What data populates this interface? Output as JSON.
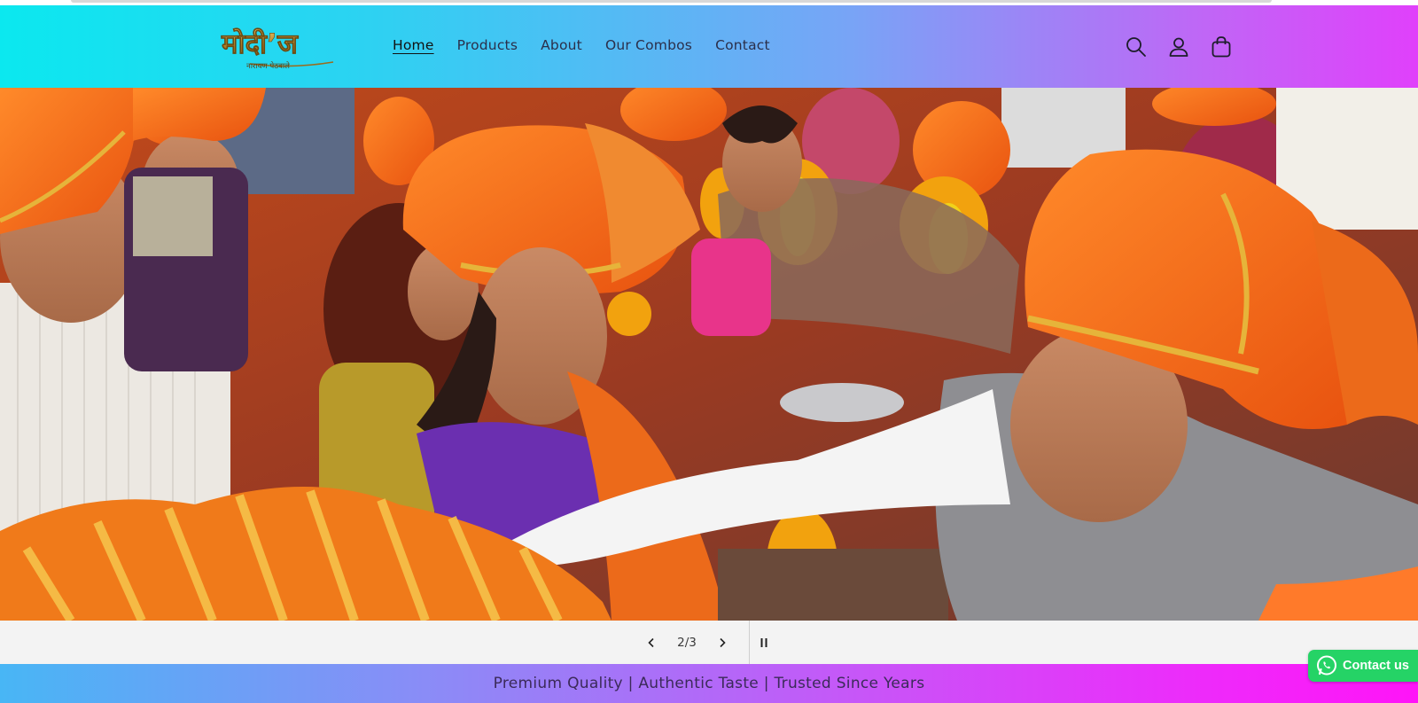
{
  "brand": {
    "logo_text": "मोदी’ज",
    "logo_subtext": "नारायण पेठवाले"
  },
  "nav": {
    "items": [
      {
        "label": "Home",
        "active": true
      },
      {
        "label": "Products",
        "active": false
      },
      {
        "label": "About",
        "active": false
      },
      {
        "label": "Our Combos",
        "active": false
      },
      {
        "label": "Contact",
        "active": false
      }
    ]
  },
  "header_icons": [
    "search-icon",
    "account-icon",
    "cart-icon"
  ],
  "hero": {
    "image": "festival-procession-with-orange-pheta-turbans-and-marigold-garlands"
  },
  "slider": {
    "counter": "2/3",
    "prev_icon": "chevron-left-icon",
    "next_icon": "chevron-right-icon",
    "pause_icon": "pause-icon"
  },
  "announcement": {
    "text": "Premium Quality | Authentic Taste | Trusted Since Years"
  },
  "whatsapp": {
    "label": "Contact us",
    "color": "#25d366"
  },
  "colors": {
    "header_gradient_start": "#0be8ef",
    "header_gradient_end": "#e040fb",
    "announce_gradient_start": "#48b6f5",
    "announce_gradient_end": "#ff14f8",
    "logo_gold": "#b8862b"
  }
}
